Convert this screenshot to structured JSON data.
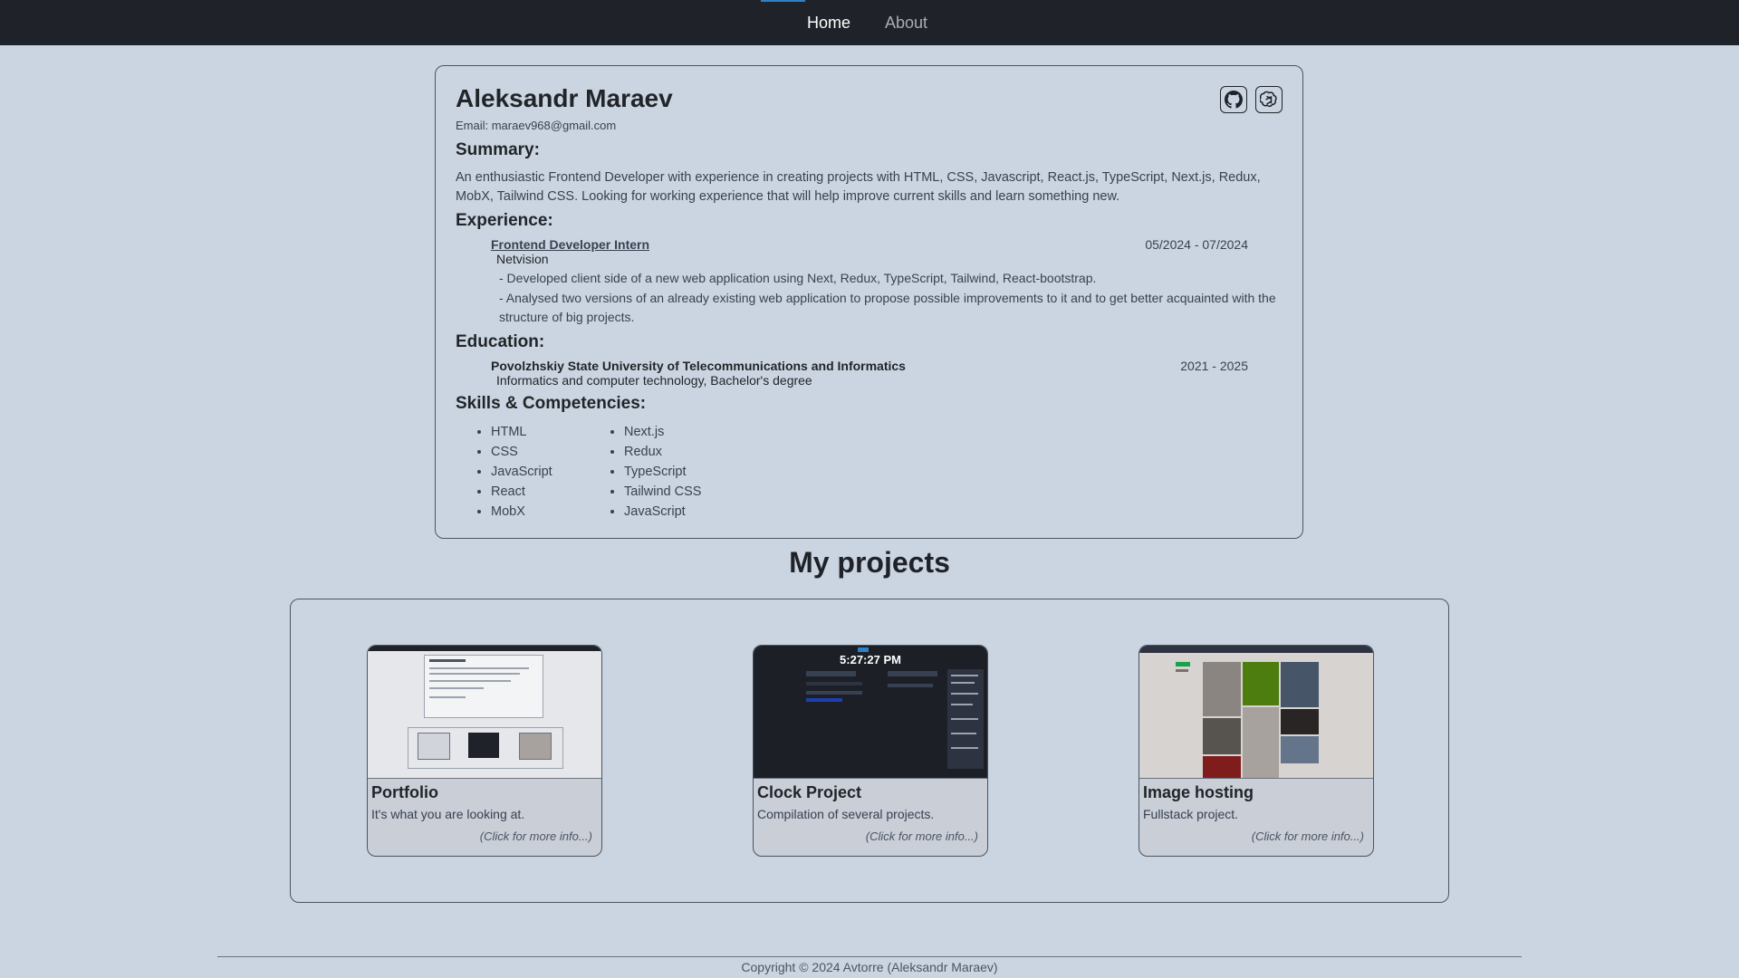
{
  "nav": {
    "home": "Home",
    "about": "About"
  },
  "resume": {
    "name": "Aleksandr Maraev",
    "email_line": "Email: maraev968@gmail.com",
    "summary_title": "Summary:",
    "summary_text": "An enthusiastic Frontend Developer with experience in creating projects with HTML, CSS, Javascript, React.js, TypeScript, Next.js, Redux, MobX, Tailwind CSS. Looking for working experience that will help improve current skills and learn something new.",
    "experience_title": "Experience:",
    "job": {
      "title": "Frontend Developer Intern",
      "dates": "05/2024 - 07/2024",
      "company": "Netvision",
      "bullets": [
        "- Developed client side of a new web application using Next, Redux, TypeScript, Tailwind, React-bootstrap.",
        "- Analysed two versions of an already existing web application to propose possible improvements to it and to get better acquainted with the structure of big projects."
      ]
    },
    "education_title": "Education:",
    "education": {
      "school": "Povolzhskiy State University of Telecommunications and Informatics",
      "years": "2021 - 2025",
      "degree": "Informatics and computer technology, Bachelor's degree"
    },
    "skills_title": "Skills & Competencies:",
    "skills_col1": [
      "HTML",
      "CSS",
      "JavaScript",
      "React",
      "MobX"
    ],
    "skills_col2": [
      "Next.js",
      "Redux",
      "TypeScript",
      "Tailwind CSS",
      "JavaScript"
    ]
  },
  "projects_heading": "My projects",
  "projects": [
    {
      "title": "Portfolio",
      "description": "It's what you are looking at.",
      "more": "(Click for more info...)"
    },
    {
      "title": "Clock Project",
      "description": "Compilation of several projects.",
      "more": "(Click for more info...)",
      "thumb_time": "5:27:27 PM"
    },
    {
      "title": "Image hosting",
      "description": "Fullstack project.",
      "more": "(Click for more info...)"
    }
  ],
  "footer": "Copyright © 2024 Avtorre (Aleksandr Maraev)",
  "icons": {
    "github": "github-icon",
    "openai": "openai-icon"
  },
  "colors": {
    "navbar": "#1f2329",
    "background": "#cbd5e1",
    "accent": "#2f80c9"
  }
}
